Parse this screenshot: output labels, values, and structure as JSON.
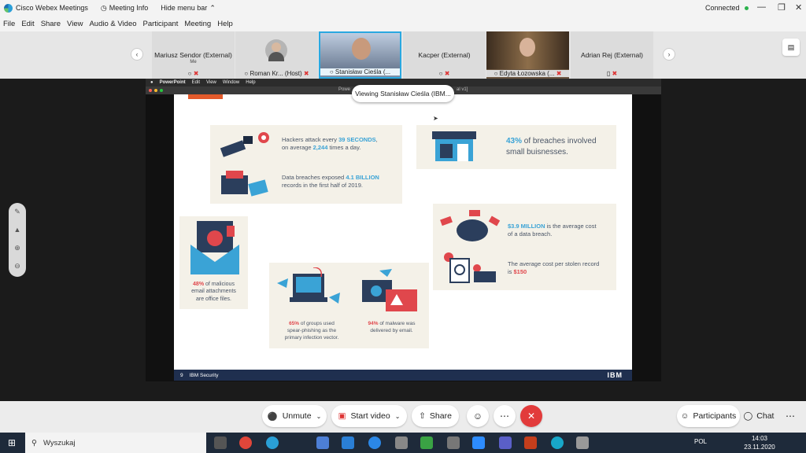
{
  "titlebar": {
    "app_name": "Cisco Webex Meetings",
    "meeting_info": "Meeting Info",
    "hide_menu": "Hide menu bar",
    "connection": "Connected"
  },
  "menu": [
    "File",
    "Edit",
    "Share",
    "View",
    "Audio & Video",
    "Participant",
    "Meeting",
    "Help"
  ],
  "participants": [
    {
      "name": "Mariusz Sendor (External)",
      "sub": "Me",
      "bottom": ""
    },
    {
      "name": "",
      "sub": "",
      "bottom": "Roman Kr...  (Host)"
    },
    {
      "name": "",
      "sub": "",
      "bottom": "Stanisław Cieśla (..."
    },
    {
      "name": "Kacper (External)",
      "sub": "",
      "bottom": ""
    },
    {
      "name": "",
      "sub": "",
      "bottom": "Edyta Łozowska (..."
    },
    {
      "name": "Adrian Rej (External)",
      "sub": "",
      "bottom": ""
    }
  ],
  "share": {
    "viewing_label": "Viewing Stanisław Cieśla (IBM...",
    "ppt_menu": [
      "PowerPoint",
      "Edit",
      "View",
      "Window",
      "Help"
    ],
    "window_title_left": "Powe",
    "window_title_right": "al v1]"
  },
  "slide": {
    "hackers_pre": "Hackers attack every ",
    "hackers_val1": "39 SECONDS",
    "hackers_mid": ",",
    "hackers_line2_pre": "on average ",
    "hackers_val2": "2,244",
    "hackers_post": " times a day.",
    "breach_pre": "Data breaches exposed ",
    "breach_val": "4.1 BILLION",
    "breach_line2": "records in the first half of 2019.",
    "small_val": "43%",
    "small_text1": " of breaches involved",
    "small_text2": "small buisnesses.",
    "cost_val": "$3.9 MILLION",
    "cost_text1": " is the average cost",
    "cost_text2": "of a data breach.",
    "record_text1": "The average cost per stolen record",
    "record_text2": "is ",
    "record_val": "$150",
    "email_val": "48%",
    "email_text1": " of malicious",
    "email_text2": "email attachments",
    "email_text3": "are office files.",
    "spear_val": "65%",
    "spear_text1": " of groups used",
    "spear_text2": "spear-phishing as the",
    "spear_text3": "primary infection vector.",
    "malware_val": "94%",
    "malware_text1": " of malware was",
    "malware_text2": "delivered by email.",
    "footer_page": "9",
    "footer_label": "IBM Security",
    "footer_logo": "IBM"
  },
  "controls": {
    "unmute": "Unmute",
    "start_video": "Start video",
    "share": "Share",
    "participants": "Participants",
    "chat": "Chat"
  },
  "taskbar": {
    "search_placeholder": "Wyszukaj",
    "lang": "POL",
    "time": "14:03",
    "date": "23.11.2020"
  },
  "colors": {
    "accent_blue": "#3aa3d6",
    "accent_red": "#e0474c",
    "leave_red": "#e23b3b",
    "taskbar": "#1e2a3a"
  }
}
